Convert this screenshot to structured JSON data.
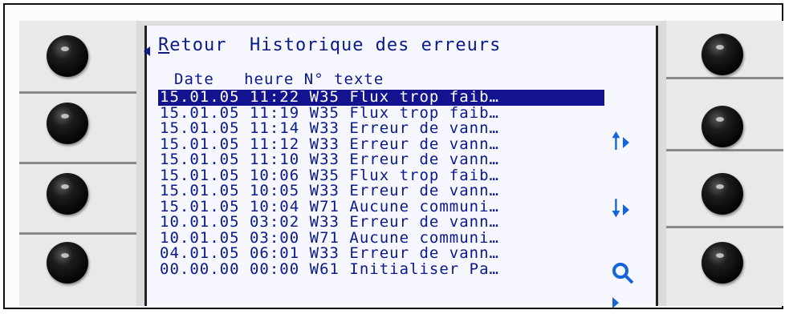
{
  "header": {
    "back_label_first": "R",
    "back_label_rest": "etour",
    "title": "Historique des erreurs"
  },
  "columns": {
    "date": "Date",
    "heure": "heure",
    "no": "N°",
    "texte": "texte"
  },
  "entries": [
    {
      "date": "15.01.05",
      "time": "11:22",
      "code": "W35",
      "text": "Flux trop faib…",
      "selected": true
    },
    {
      "date": "15.01.05",
      "time": "11:19",
      "code": "W35",
      "text": "Flux trop faib…"
    },
    {
      "date": "15.01.05",
      "time": "11:14",
      "code": "W33",
      "text": "Erreur de vann…"
    },
    {
      "date": "15.01.05",
      "time": "11:12",
      "code": "W33",
      "text": "Erreur de vann…"
    },
    {
      "date": "15.01.05",
      "time": "11:10",
      "code": "W33",
      "text": "Erreur de vann…"
    },
    {
      "date": "15.01.05",
      "time": "10:06",
      "code": "W35",
      "text": "Flux trop faib…"
    },
    {
      "date": "15.01.05",
      "time": "10:05",
      "code": "W33",
      "text": "Erreur de vann…"
    },
    {
      "date": "15.01.05",
      "time": "10:04",
      "code": "W71",
      "text": "Aucune communi…"
    },
    {
      "date": "10.01.05",
      "time": "03:02",
      "code": "W33",
      "text": "Erreur de vann…"
    },
    {
      "date": "10.01.05",
      "time": "03:00",
      "code": "W71",
      "text": "Aucune communi…"
    },
    {
      "date": "04.01.05",
      "time": "06:01",
      "code": "W33",
      "text": "Erreur de vann…"
    },
    {
      "date": "00.00.00",
      "time": "00:00",
      "code": "W61",
      "text": "Initialiser Pa…"
    }
  ],
  "icons": {
    "up": "arrow-up-icon",
    "down": "arrow-down-icon",
    "search": "magnifier-icon"
  },
  "colors": {
    "lcd_text": "#0b1a8a",
    "selection": "#13138f",
    "side_icons": "#1565d8"
  }
}
